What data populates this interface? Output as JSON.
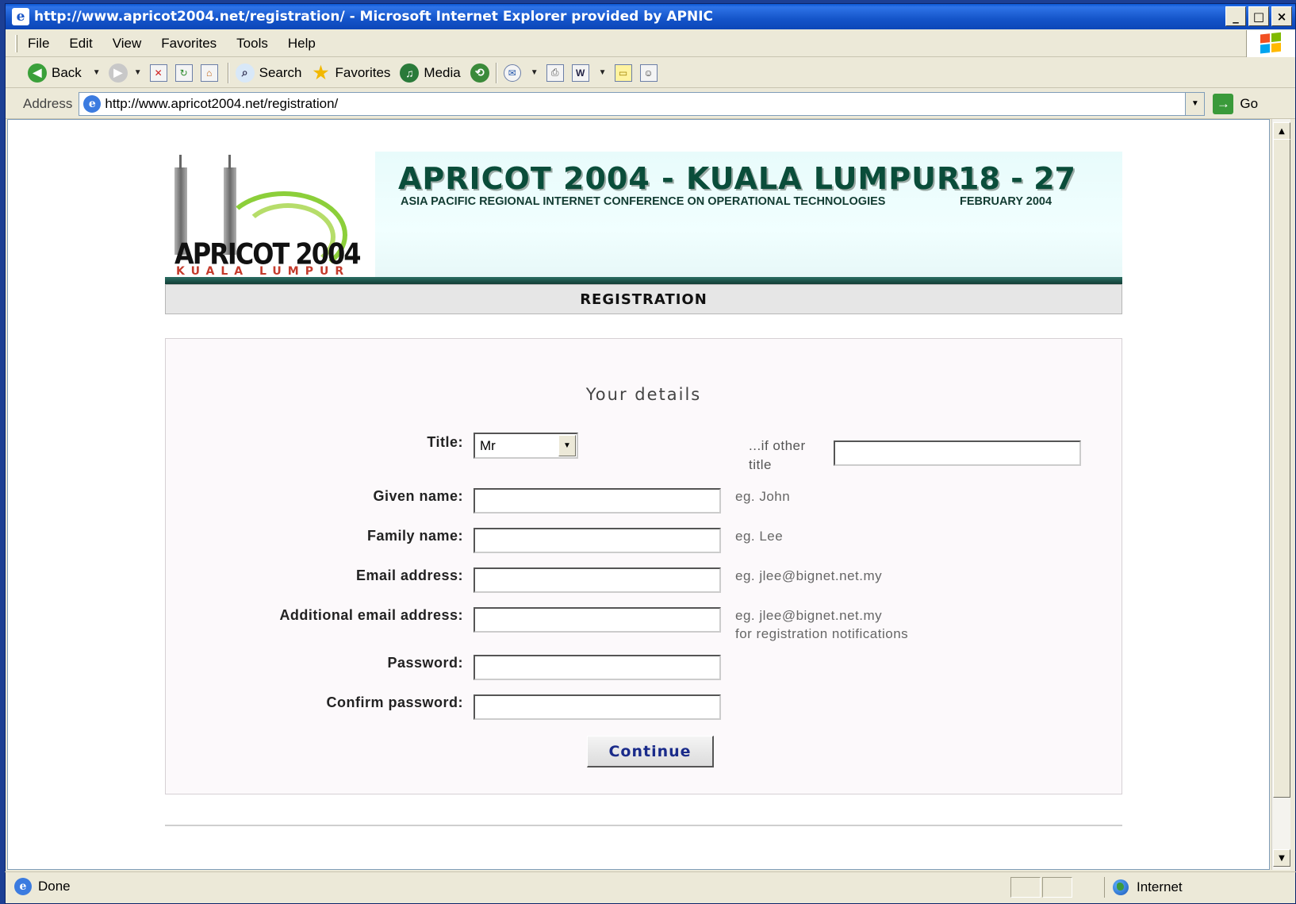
{
  "window": {
    "title": "http://www.apricot2004.net/registration/ - Microsoft Internet Explorer provided by APNIC",
    "min": "_",
    "max": "□",
    "close": "×"
  },
  "menu": [
    "File",
    "Edit",
    "View",
    "Favorites",
    "Tools",
    "Help"
  ],
  "toolbar": {
    "back": "Back",
    "search": "Search",
    "favorites": "Favorites",
    "media": "Media"
  },
  "address": {
    "label": "Address",
    "url": "http://www.apricot2004.net/registration/",
    "go": "Go"
  },
  "banner": {
    "logo_main": "APRICOT 2004",
    "logo_sub": "KUALA LUMPUR",
    "title": "APRICOT 2004 - KUALA LUMPUR",
    "subtitle": "ASIA PACIFIC REGIONAL INTERNET CONFERENCE ON OPERATIONAL TECHNOLOGIES",
    "dates": "18 - 27",
    "month": "FEBRUARY 2004"
  },
  "section": "REGISTRATION",
  "form": {
    "heading": "Your details",
    "title_label": "Title:",
    "title_value": "Mr",
    "other_title_label": "...if other title",
    "given_label": "Given name:",
    "given_hint": "eg. John",
    "family_label": "Family name:",
    "family_hint": "eg. Lee",
    "email_label": "Email address:",
    "email_hint": "eg. jlee@bignet.net.my",
    "add_email_label": "Additional email address:",
    "add_email_hint1": "eg. jlee@bignet.net.my",
    "add_email_hint2": "for registration notifications",
    "password_label": "Password:",
    "confirm_label": "Confirm password:",
    "continue": "Continue"
  },
  "status": {
    "text": "Done",
    "zone": "Internet"
  },
  "colors": {
    "titlebar": "#1454c9",
    "banner_text": "#0a4d3a",
    "button_text": "#1a2b8a"
  }
}
